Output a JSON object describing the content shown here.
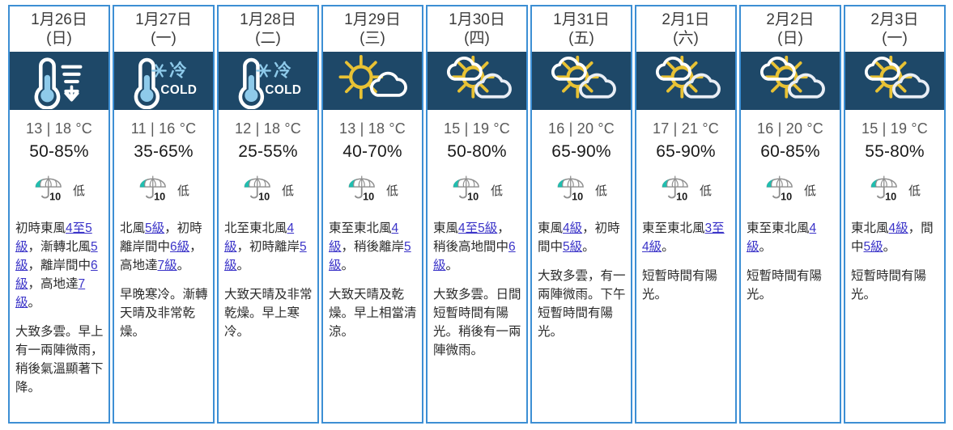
{
  "accent": {
    "border_blue": "#3d8fd4",
    "icon_band_navy": "#1e4868",
    "sun_yellow": "#e8c234",
    "link_purple": "#3a33c8",
    "umbrella_teal": "#1fbfb0",
    "thermometer_blue": "#8ecaea"
  },
  "uv": {
    "value": "10",
    "level_label": "低",
    "icon": "umbrella-uv-icon"
  },
  "days": [
    {
      "date": "1月26日",
      "dow": "(日)",
      "icon": "temperature-falling-icon",
      "icon_label": "氣溫下降",
      "temp": "13 | 18 °C",
      "humidity": "50-85%",
      "uv_value": "10",
      "uv_level": "低",
      "wind": [
        {
          "t": "初時東風",
          "link": false
        },
        {
          "t": "4至5級",
          "link": true
        },
        {
          "t": "，漸轉北風",
          "link": false
        },
        {
          "t": "5級",
          "link": true
        },
        {
          "t": "，離岸間中",
          "link": false
        },
        {
          "t": "6級",
          "link": true
        },
        {
          "t": "，高地達",
          "link": false
        },
        {
          "t": "7級",
          "link": true
        },
        {
          "t": "。",
          "link": false
        }
      ],
      "sky": "大致多雲。早上有一兩陣微雨，稍後氣溫顯著下降。"
    },
    {
      "date": "1月27日",
      "dow": "(一)",
      "icon": "cold-thermometer-icon",
      "icon_label": "寒冷 COLD",
      "temp": "11 | 16 °C",
      "humidity": "35-65%",
      "uv_value": "10",
      "uv_level": "低",
      "wind": [
        {
          "t": "北風",
          "link": false
        },
        {
          "t": "5級",
          "link": true
        },
        {
          "t": "，初時離岸間中",
          "link": false
        },
        {
          "t": "6級",
          "link": true
        },
        {
          "t": "，高地達",
          "link": false
        },
        {
          "t": "7級",
          "link": true
        },
        {
          "t": "。",
          "link": false
        }
      ],
      "sky": "早晚寒冷。漸轉天晴及非常乾燥。"
    },
    {
      "date": "1月28日",
      "dow": "(二)",
      "icon": "cold-thermometer-icon",
      "icon_label": "寒冷 COLD",
      "temp": "12 | 18 °C",
      "humidity": "25-55%",
      "uv_value": "10",
      "uv_level": "低",
      "wind": [
        {
          "t": "北至東北風",
          "link": false
        },
        {
          "t": "4級",
          "link": true
        },
        {
          "t": "，初時離岸",
          "link": false
        },
        {
          "t": "5級",
          "link": true
        },
        {
          "t": "。",
          "link": false
        }
      ],
      "sky": "大致天晴及非常乾燥。早上寒冷。"
    },
    {
      "date": "1月29日",
      "dow": "(三)",
      "icon": "sunny-periods-icon",
      "icon_label": "天晴",
      "temp": "13 | 18 °C",
      "humidity": "40-70%",
      "uv_value": "10",
      "uv_level": "低",
      "wind": [
        {
          "t": "東至東北風",
          "link": false
        },
        {
          "t": "4級",
          "link": true
        },
        {
          "t": "，稍後離岸",
          "link": false
        },
        {
          "t": "5級",
          "link": true
        },
        {
          "t": "。",
          "link": false
        }
      ],
      "sky": "大致天晴及乾燥。早上相當清涼。"
    },
    {
      "date": "1月30日",
      "dow": "(四)",
      "icon": "cloudy-sunny-intervals-icon",
      "icon_label": "短暫時間有陽光",
      "temp": "15 | 19 °C",
      "humidity": "50-80%",
      "uv_value": "10",
      "uv_level": "低",
      "wind": [
        {
          "t": "東風",
          "link": false
        },
        {
          "t": "4至5級",
          "link": true
        },
        {
          "t": "，稍後高地間中",
          "link": false
        },
        {
          "t": "6級",
          "link": true
        },
        {
          "t": "。",
          "link": false
        }
      ],
      "sky": "大致多雲。日間短暫時間有陽光。稍後有一兩陣微雨。"
    },
    {
      "date": "1月31日",
      "dow": "(五)",
      "icon": "cloudy-sunny-intervals-icon",
      "icon_label": "短暫時間有陽光",
      "temp": "16 | 20 °C",
      "humidity": "65-90%",
      "uv_value": "10",
      "uv_level": "低",
      "wind": [
        {
          "t": "東風",
          "link": false
        },
        {
          "t": "4級",
          "link": true
        },
        {
          "t": "，初時間中",
          "link": false
        },
        {
          "t": "5級",
          "link": true
        },
        {
          "t": "。",
          "link": false
        }
      ],
      "sky": "大致多雲，有一兩陣微雨。下午短暫時間有陽光。"
    },
    {
      "date": "2月1日",
      "dow": "(六)",
      "icon": "cloudy-sunny-intervals-icon",
      "icon_label": "短暫時間有陽光",
      "temp": "17 | 21 °C",
      "humidity": "65-90%",
      "uv_value": "10",
      "uv_level": "低",
      "wind": [
        {
          "t": "東至東北風",
          "link": false
        },
        {
          "t": "3至4級",
          "link": true
        },
        {
          "t": "。",
          "link": false
        }
      ],
      "sky": "短暫時間有陽光。"
    },
    {
      "date": "2月2日",
      "dow": "(日)",
      "icon": "cloudy-sunny-intervals-icon",
      "icon_label": "短暫時間有陽光",
      "temp": "16 | 20 °C",
      "humidity": "60-85%",
      "uv_value": "10",
      "uv_level": "低",
      "wind": [
        {
          "t": "東至東北風",
          "link": false
        },
        {
          "t": "4級",
          "link": true
        },
        {
          "t": "。",
          "link": false
        }
      ],
      "sky": "短暫時間有陽光。"
    },
    {
      "date": "2月3日",
      "dow": "(一)",
      "icon": "cloudy-sunny-intervals-icon",
      "icon_label": "短暫時間有陽光",
      "temp": "15 | 19 °C",
      "humidity": "55-80%",
      "uv_value": "10",
      "uv_level": "低",
      "wind": [
        {
          "t": "東北風",
          "link": false
        },
        {
          "t": "4級",
          "link": true
        },
        {
          "t": "，間中",
          "link": false
        },
        {
          "t": "5級",
          "link": true
        },
        {
          "t": "。",
          "link": false
        }
      ],
      "sky": "短暫時間有陽光。"
    }
  ]
}
